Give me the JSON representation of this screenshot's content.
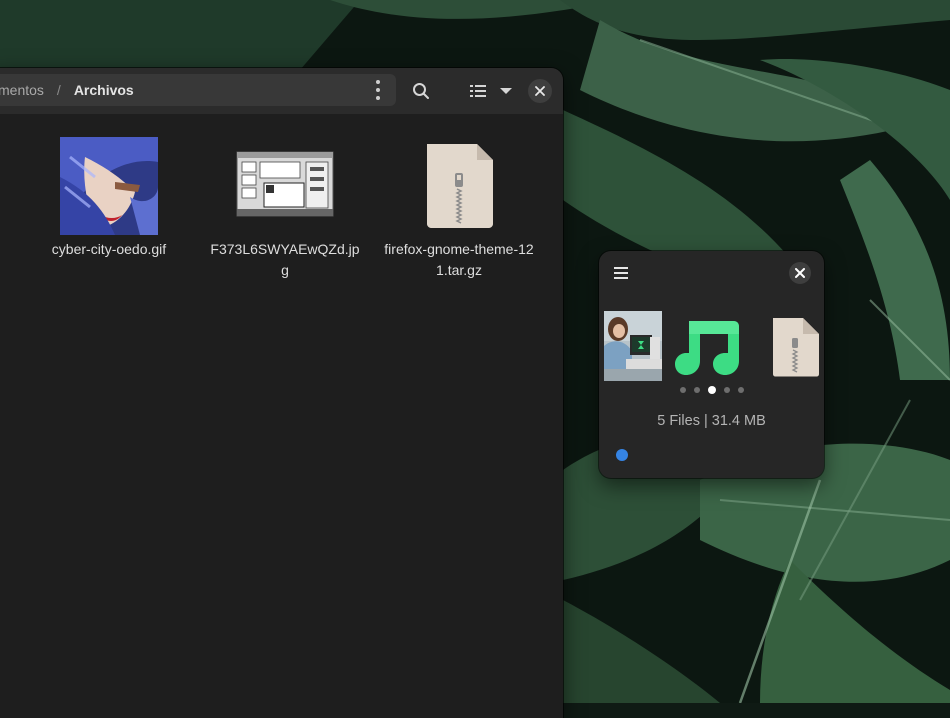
{
  "file_manager": {
    "breadcrumb": {
      "previous": "mentos",
      "separator": "/",
      "current": "Archivos"
    },
    "toolbar": {
      "icons": [
        "kebab-menu-icon",
        "search-icon",
        "list-view-icon",
        "chevron-down-icon",
        "close-icon"
      ]
    },
    "files": [
      {
        "name": "cyber-city-oedo.gif",
        "type": "image"
      },
      {
        "name": "F373L6SWYAEwQZd.jpg",
        "type": "image"
      },
      {
        "name": "firefox-gnome-theme-121.tar.gz",
        "type": "archive"
      }
    ]
  },
  "shelf": {
    "icons": [
      "hamburger-menu-icon",
      "close-icon"
    ],
    "carousel_items": [
      "image-thumbnail",
      "music-note-icon",
      "archive-icon"
    ],
    "dots_total": 5,
    "dots_active_index": 2,
    "summary": "5 Files | 31.4 MB",
    "colors": {
      "accent": "#3584e4",
      "music": "#3ddc84"
    }
  }
}
